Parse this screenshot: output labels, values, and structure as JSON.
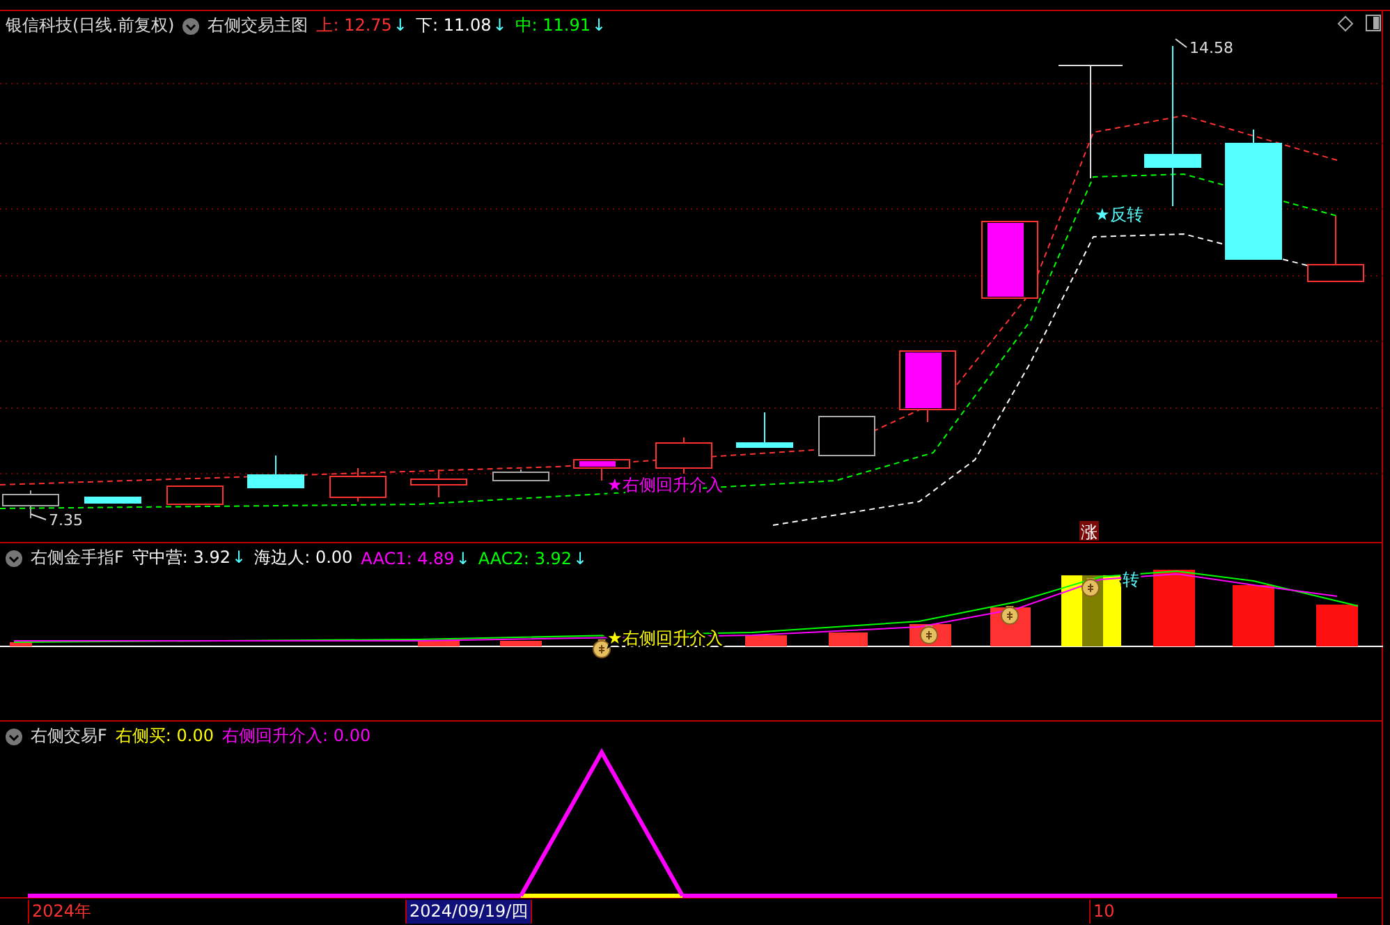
{
  "main_pane": {
    "title": "银信科技(日线.前复权)",
    "indicator": "右侧交易主图",
    "values": [
      {
        "label": "上:",
        "value": "12.75",
        "arrow": "↓",
        "color": "#ff3232"
      },
      {
        "label": "下:",
        "value": "11.08",
        "arrow": "↓",
        "color": "#ffffff"
      },
      {
        "label": "中:",
        "value": "11.91",
        "arrow": "↓",
        "color": "#00ff00"
      }
    ],
    "annotations": [
      {
        "kind": "signal",
        "text": "★右侧回升介入",
        "color": "#ff00ff"
      },
      {
        "kind": "signal",
        "text": "★反转",
        "color": "#54ffff"
      },
      {
        "kind": "high",
        "text": "14.58"
      },
      {
        "kind": "low",
        "text": "7.35"
      },
      {
        "kind": "badge",
        "text": "涨"
      }
    ]
  },
  "indicator_pane": {
    "indicator": "右侧金手指F",
    "values": [
      {
        "label": "守中营:",
        "value": "3.92",
        "arrow": "↓",
        "color": "#ffffff"
      },
      {
        "label": "海边人:",
        "value": "0.00",
        "color": "#ffffff"
      },
      {
        "label": "AAC1:",
        "value": "4.89",
        "arrow": "↓",
        "color": "#ff00ff"
      },
      {
        "label": "AAC2:",
        "value": "3.92",
        "arrow": "↓",
        "color": "#00ff00"
      }
    ],
    "annotations": [
      {
        "text": "★右侧回升介入"
      },
      {
        "text": "转"
      }
    ]
  },
  "signal_pane": {
    "indicator": "右侧交易F",
    "values": [
      {
        "label": "右侧买:",
        "value": "0.00",
        "color": "#ffff00"
      },
      {
        "label": "右侧回升介入:",
        "value": "0.00",
        "color": "#ff00ff"
      }
    ]
  },
  "date_axis": [
    {
      "text": "2024年",
      "selected": false
    },
    {
      "text": "2024/09/19/四",
      "selected": true
    },
    {
      "text": "10",
      "selected": false
    }
  ]
}
